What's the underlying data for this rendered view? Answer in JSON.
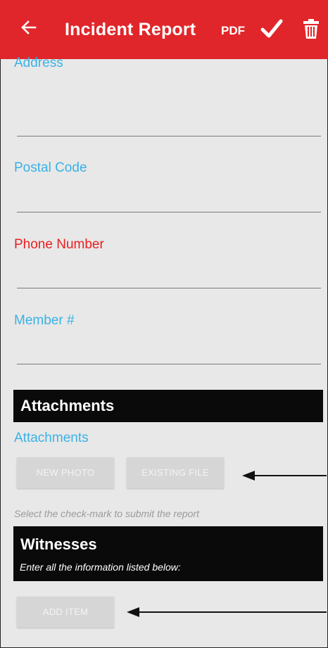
{
  "header": {
    "title": "Incident Report",
    "pdf_label": "PDF",
    "back_icon": "arrow-left-icon",
    "check_icon": "checkmark-icon",
    "trash_icon": "trash-icon",
    "background": "#e0262a"
  },
  "fields": {
    "address_label": "Address",
    "postal_label": "Postal Code",
    "phone_label": "Phone Number",
    "member_label": "Member #"
  },
  "attachments": {
    "section_title": "Attachments",
    "field_label": "Attachments",
    "new_photo_label": "NEW PHOTO",
    "existing_file_label": "EXISTING FILE"
  },
  "hint": "Select the check-mark to submit the report",
  "witnesses": {
    "section_title": "Witnesses",
    "subtitle": "Enter all the information listed below:",
    "add_item_label": "ADD ITEM"
  },
  "colors": {
    "label_blue": "#39b2e6",
    "label_red": "#e8201f",
    "section_bg": "#0a0a0a",
    "page_bg": "#e8e8e8"
  }
}
